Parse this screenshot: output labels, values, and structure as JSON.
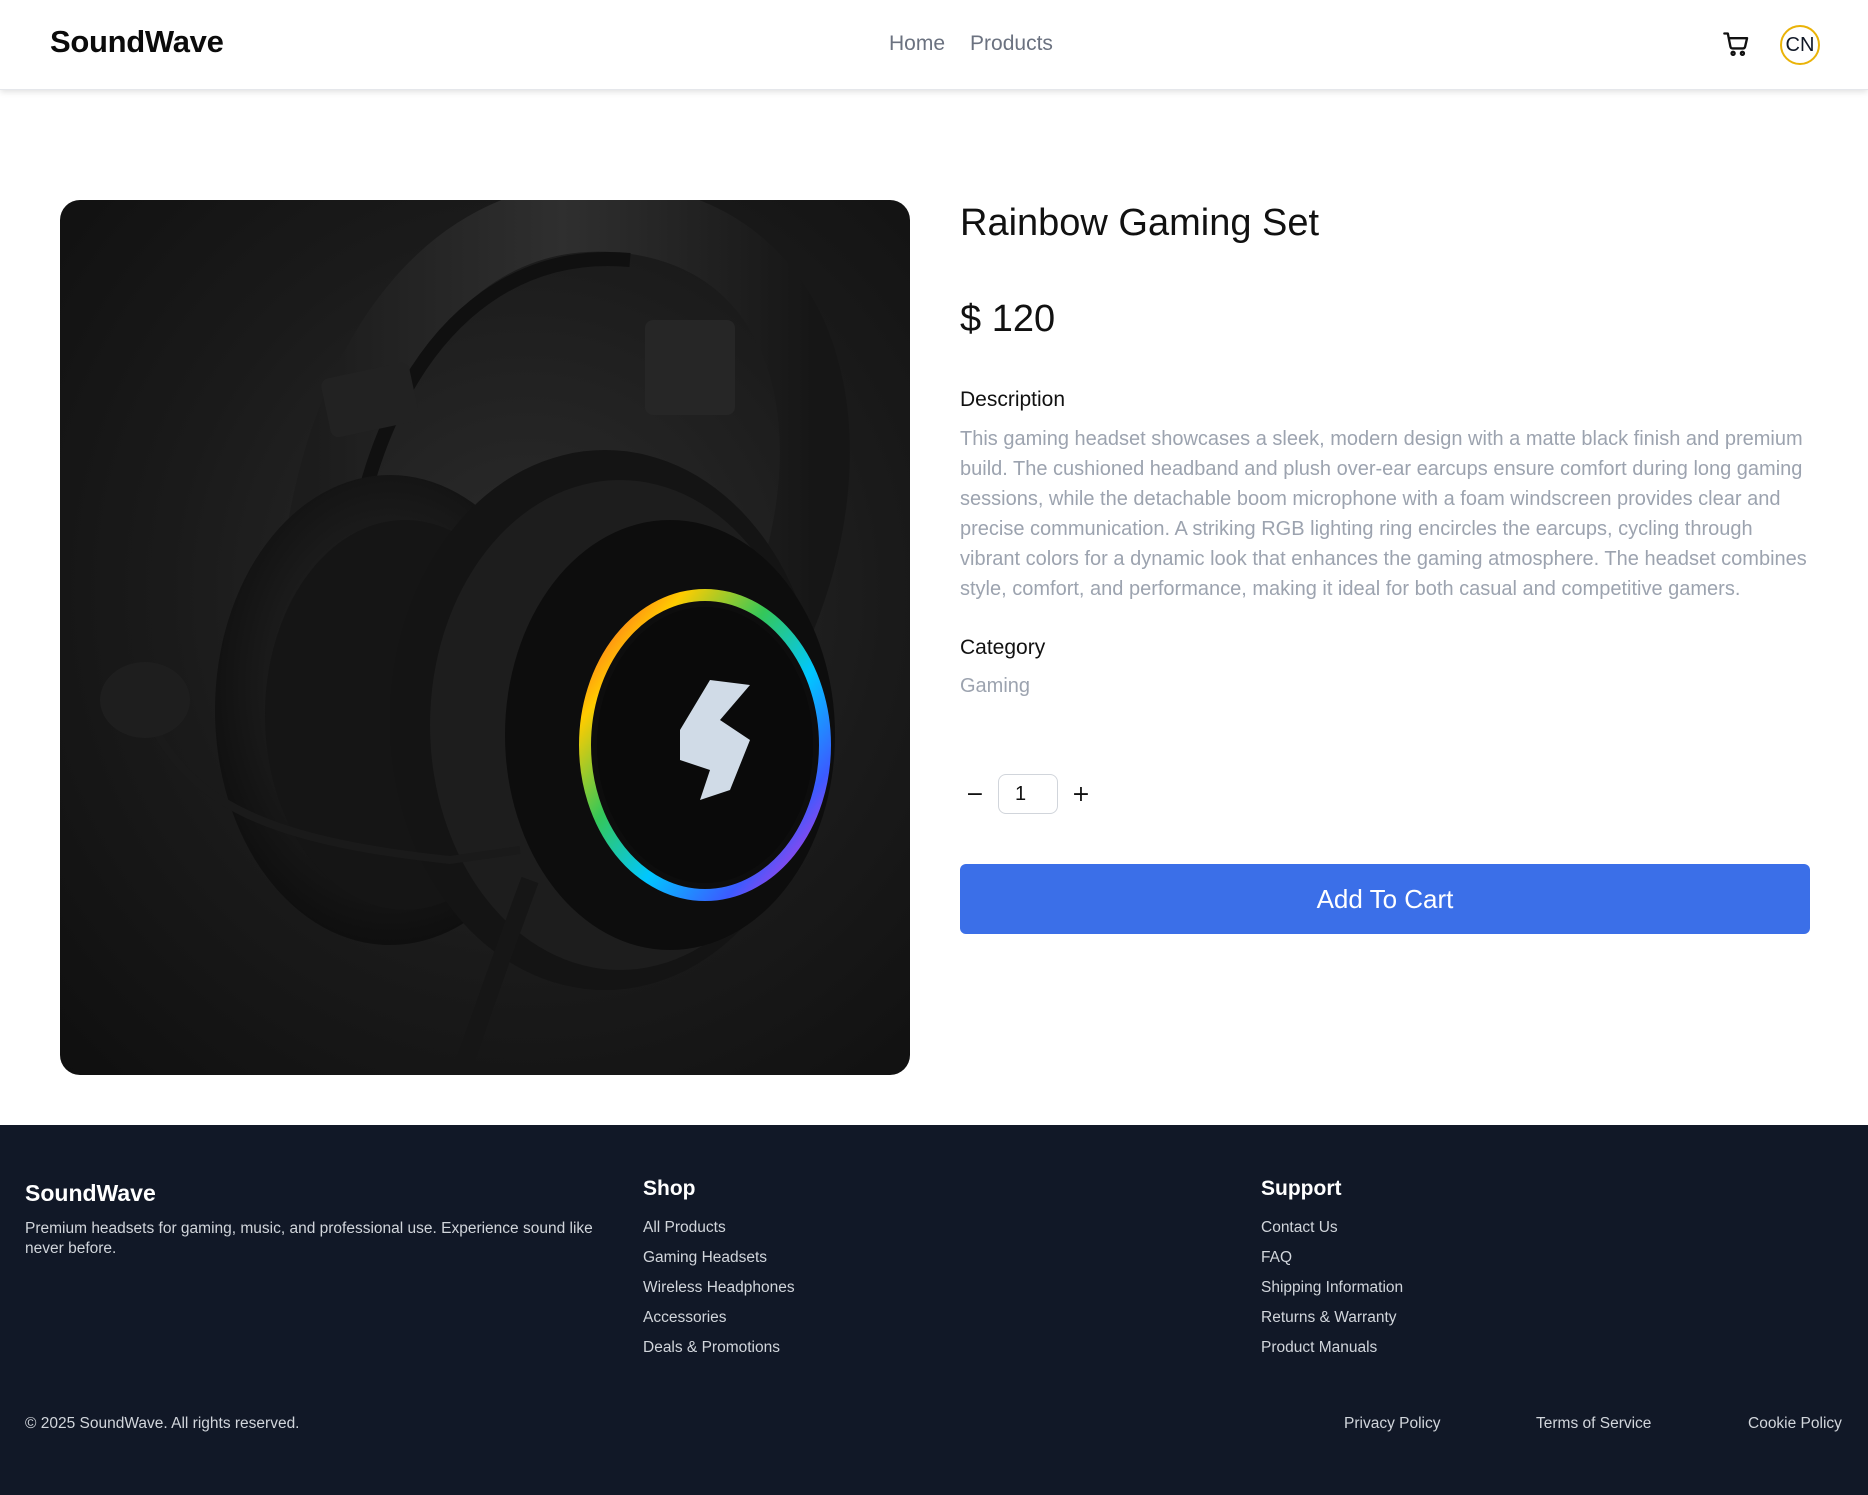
{
  "header": {
    "brand": "SoundWave",
    "nav": [
      "Home",
      "Products"
    ],
    "avatar_initials": "CN",
    "cart_icon": "cart-icon"
  },
  "product": {
    "title": "Rainbow Gaming Set",
    "price": "$ 120",
    "description_label": "Description",
    "description": "This gaming headset showcases a sleek, modern design with a matte black finish and premium build. The cushioned headband and plush over-ear earcups ensure comfort during long gaming sessions, while the detachable boom microphone with a foam windscreen provides clear and precise communication. A striking RGB lighting ring encircles the earcups, cycling through vibrant colors for a dynamic look that enhances the gaming atmosphere. The headset combines style, comfort, and performance, making it ideal for both casual and competitive gamers.",
    "category_label": "Category",
    "category": "Gaming",
    "quantity": "1",
    "decrement_label": "−",
    "increment_label": "+",
    "add_to_cart_label": "Add To Cart"
  },
  "footer": {
    "brand": "SoundWave",
    "tagline": "Premium headsets for gaming, music, and professional use. Experience sound like never before.",
    "shop": {
      "heading": "Shop",
      "links": [
        "All Products",
        "Gaming Headsets",
        "Wireless Headphones",
        "Accessories",
        "Deals & Promotions"
      ]
    },
    "support": {
      "heading": "Support",
      "links": [
        "Contact Us",
        "FAQ",
        "Shipping Information",
        "Returns & Warranty",
        "Product Manuals"
      ]
    },
    "copyright": "© 2025 SoundWave. All rights reserved.",
    "legal": [
      "Privacy Policy",
      "Terms of Service",
      "Cookie Policy"
    ]
  },
  "colors": {
    "primary_button": "#3b6fe8",
    "footer_bg": "#111827",
    "avatar_ring": "#eab308"
  }
}
